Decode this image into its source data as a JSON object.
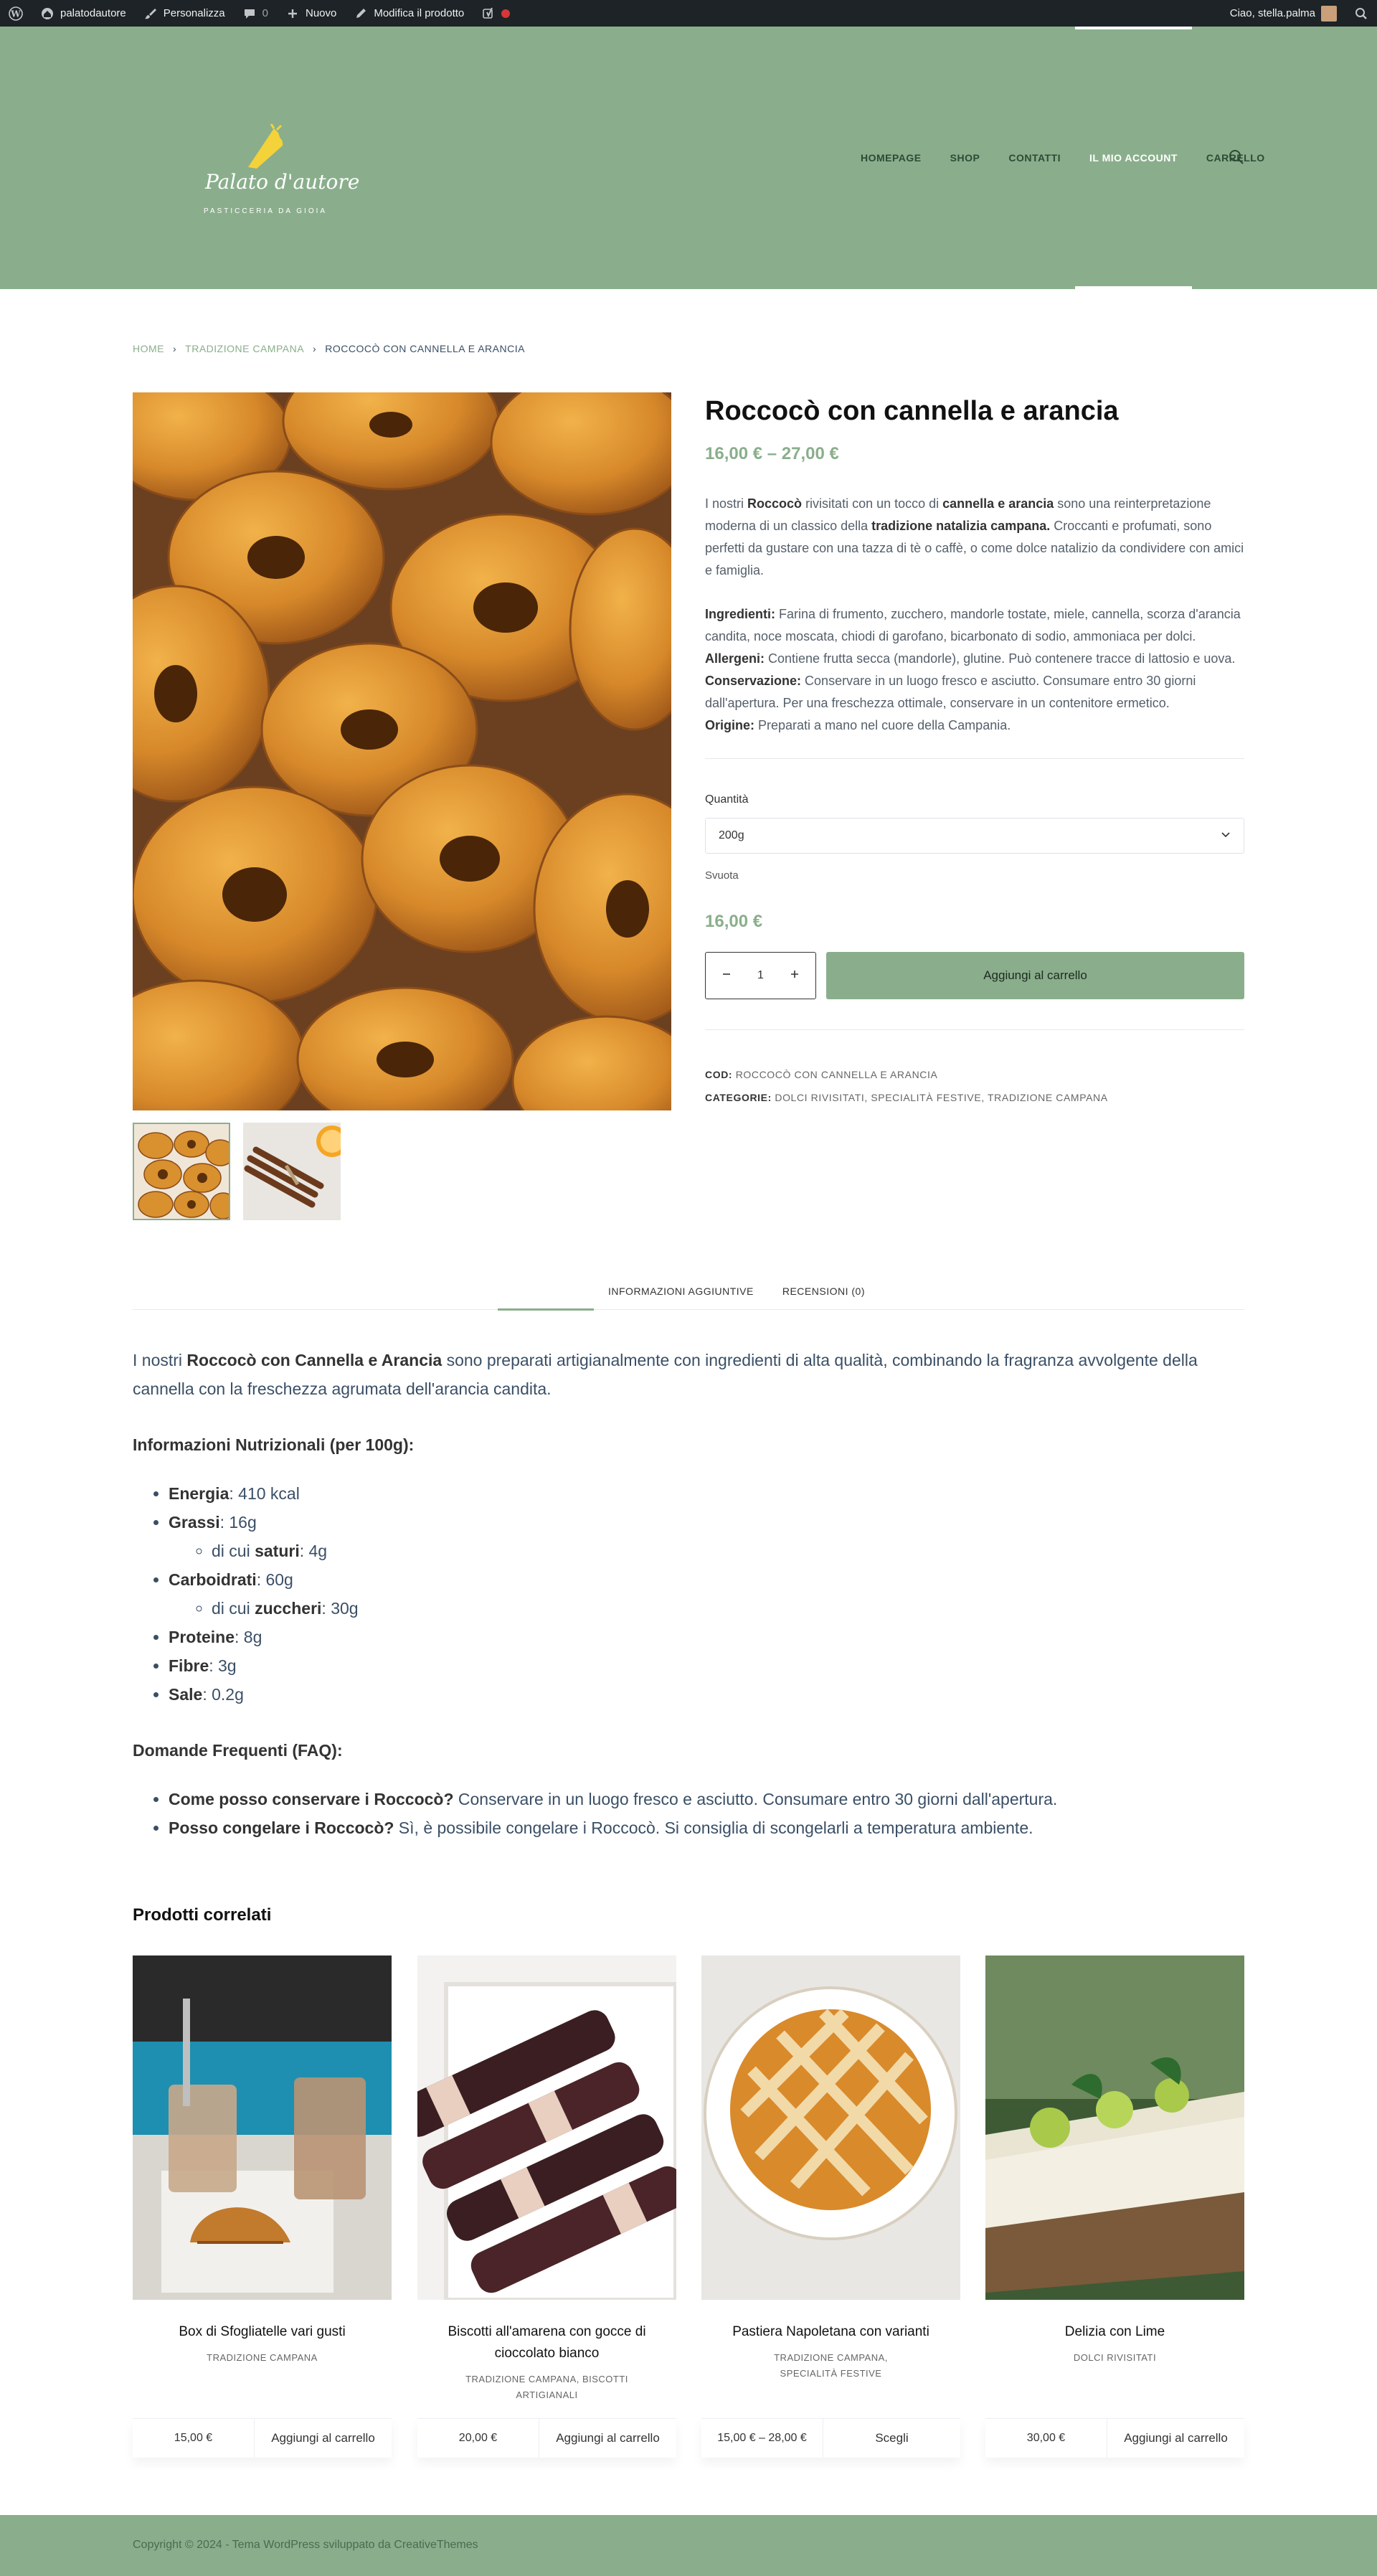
{
  "admin_bar": {
    "site_name": "palatodautore",
    "customize": "Personalizza",
    "comments_count": "0",
    "new": "Nuovo",
    "edit_product": "Modifica il prodotto",
    "greeting": "Ciao, stella.palma"
  },
  "header": {
    "logo_text": "Palato d'autore",
    "logo_sub": "PASTICCERIA DA GIOIA",
    "nav": [
      "HOMEPAGE",
      "SHOP",
      "CONTATTI",
      "IL MIO ACCOUNT",
      "CARRELLO"
    ],
    "active_nav": "IL MIO ACCOUNT"
  },
  "breadcrumb": {
    "home": "HOME",
    "category": "TRADIZIONE CAMPANA",
    "current": "ROCCOCÒ CON CANNELLA E ARANCIA"
  },
  "product": {
    "title": "Roccocò con cannella e arancia",
    "price_range": "16,00 € – 27,00 €",
    "desc_intro_1": "I nostri ",
    "desc_intro_b1": "Roccocò",
    "desc_intro_2": " rivisitati con un tocco di ",
    "desc_intro_b2": "cannella e arancia",
    "desc_intro_3": " sono una reinterpretazione moderna di un classico della ",
    "desc_intro_b3": "tradizione natalizia campana.",
    "desc_intro_4": " Croccanti e profumati, sono perfetti da gustare con una tazza di tè o caffè, o come dolce natalizio da condividere con amici e famiglia.",
    "ingredients_label": "Ingredienti:",
    "ingredients": " Farina di frumento, zucchero, mandorle tostate, miele, cannella, scorza d'arancia candita, noce moscata, chiodi di garofano, bicarbonato di sodio, ammoniaca per dolci.",
    "allergens_label": "Allergeni:",
    "allergens": " Contiene frutta secca (mandorle), glutine. Può contenere tracce di lattosio e uova.",
    "storage_label": "Conservazione:",
    "storage": " Conservare in un luogo fresco e asciutto. Consumare entro 30 giorni dall'apertura. Per una freschezza ottimale, conservare in un contenitore ermetico.",
    "origin_label": "Origine:",
    "origin": " Preparati a mano nel cuore della Campania.",
    "quantity_label": "Quantità",
    "quantity_selected": "200g",
    "clear_label": "Svuota",
    "variation_price": "16,00 €",
    "qty_value": "1",
    "add_to_cart": "Aggiungi al carrello",
    "sku_label": "COD:",
    "sku": "ROCCOCÒ CON CANNELLA E ARANCIA",
    "categories_label": "CATEGORIE:",
    "categories": [
      "DOLCI RIVISITATI",
      "SPECIALITÀ FESTIVE",
      "TRADIZIONE CAMPANA"
    ]
  },
  "tabs": [
    "",
    "INFORMAZIONI AGGIUNTIVE",
    "RECENSIONI (0)"
  ],
  "description": {
    "intro_1": "I nostri ",
    "intro_b": "Roccocò con Cannella e Arancia",
    "intro_2": " sono preparati artigianalmente con ingredienti di alta qualità, combinando la fragranza avvolgente della cannella con la freschezza agrumata dell'arancia candita.",
    "nutrition_title": "Informazioni Nutrizionali (per 100g):",
    "nutrition": [
      {
        "label": "Energia",
        "value": ": 410 kcal"
      },
      {
        "label": "Grassi",
        "value": ": 16g"
      },
      {
        "sub_pre": "di cui ",
        "sub_label": "saturi",
        "sub_value": ": 4g"
      },
      {
        "label": "Carboidrati",
        "value": ": 60g"
      },
      {
        "sub_pre": "di cui ",
        "sub_label": "zuccheri",
        "sub_value": ": 30g"
      },
      {
        "label": "Proteine",
        "value": ": 8g"
      },
      {
        "label": "Fibre",
        "value": ": 3g"
      },
      {
        "label": "Sale",
        "value": ": 0.2g"
      }
    ],
    "faq_title": "Domande Frequenti (FAQ):",
    "faq": [
      {
        "q": "Come posso conservare i Roccocò?",
        "a": " Conservare in un luogo fresco e asciutto. Consumare entro 30 giorni dall'apertura."
      },
      {
        "q": "Posso congelare i Roccocò?",
        "a": " Sì, è possibile congelare i Roccocò. Si consiglia di scongelarli a temperatura ambiente."
      }
    ]
  },
  "related": {
    "title": "Prodotti correlati",
    "items": [
      {
        "name": "Box di Sfogliatelle vari gusti",
        "cat": "TRADIZIONE CAMPANA",
        "price": "15,00 €",
        "btn": "Aggiungi al carrello"
      },
      {
        "name": "Biscotti all'amarena con gocce di cioccolato bianco",
        "cat": "TRADIZIONE CAMPANA, BISCOTTI ARTIGIANALI",
        "price": "20,00 €",
        "btn": "Aggiungi al carrello"
      },
      {
        "name": "Pastiera Napoletana con varianti",
        "cat": "TRADIZIONE CAMPANA, SPECIALITÀ FESTIVE",
        "price": "15,00 € – 28,00 €",
        "btn": "Scegli"
      },
      {
        "name": "Delizia con Lime",
        "cat": "DOLCI RIVISITATI",
        "price": "30,00 €",
        "btn": "Aggiungi al carrello"
      }
    ]
  },
  "footer": {
    "copyright": "Copyright © 2024 - Tema WordPress sviluppato da CreativeThemes"
  },
  "colors": {
    "accent": "#8aae8c",
    "admin_bar": "#1d2327",
    "text": "#3a4f66"
  }
}
